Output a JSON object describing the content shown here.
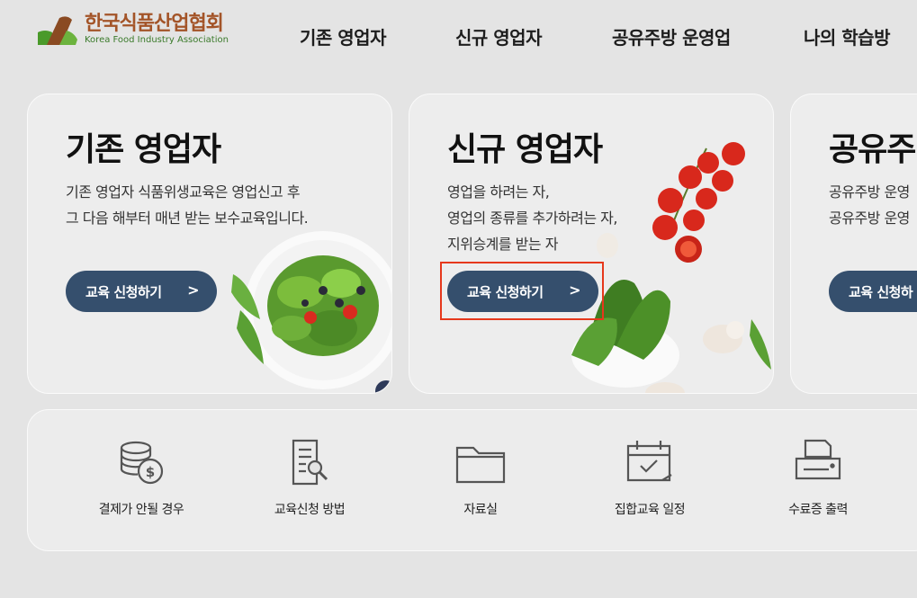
{
  "logo": {
    "name_ko": "한국식품산업협회",
    "name_en": "Korea Food Industry Association"
  },
  "nav": {
    "items": [
      {
        "label": "기존 영업자"
      },
      {
        "label": "신규 영업자"
      },
      {
        "label": "공유주방 운영업"
      },
      {
        "label": "나의 학습방"
      }
    ]
  },
  "cards": [
    {
      "title": "기존 영업자",
      "desc": [
        "기존 영업자 식품위생교육은 영업신고 후",
        "그 다음 해부터 매년 받는 보수교육입니다."
      ],
      "button": "교육 신청하기",
      "arrow": ">"
    },
    {
      "title": "신규 영업자",
      "desc": [
        "영업을 하려는 자,",
        "영업의 종류를 추가하려는 자,",
        "지위승계를 받는 자"
      ],
      "button": "교육 신청하기",
      "arrow": ">"
    },
    {
      "title": "공유주",
      "desc": [
        "공유주방 운영",
        "공유주방 운영"
      ],
      "button": "교육 신청하",
      "arrow": ""
    }
  ],
  "quick_links": [
    {
      "label": "결제가 안될 경우",
      "icon": "coins-icon"
    },
    {
      "label": "교육신청 방법",
      "icon": "document-search-icon"
    },
    {
      "label": "자료실",
      "icon": "folder-icon"
    },
    {
      "label": "집합교육 일정",
      "icon": "calendar-check-icon"
    },
    {
      "label": "수료증 출력",
      "icon": "printer-icon"
    }
  ],
  "colors": {
    "button": "#354f6d",
    "highlight": "#e6381c",
    "logo_brown": "#a35428",
    "logo_green": "#3a7a2a"
  }
}
